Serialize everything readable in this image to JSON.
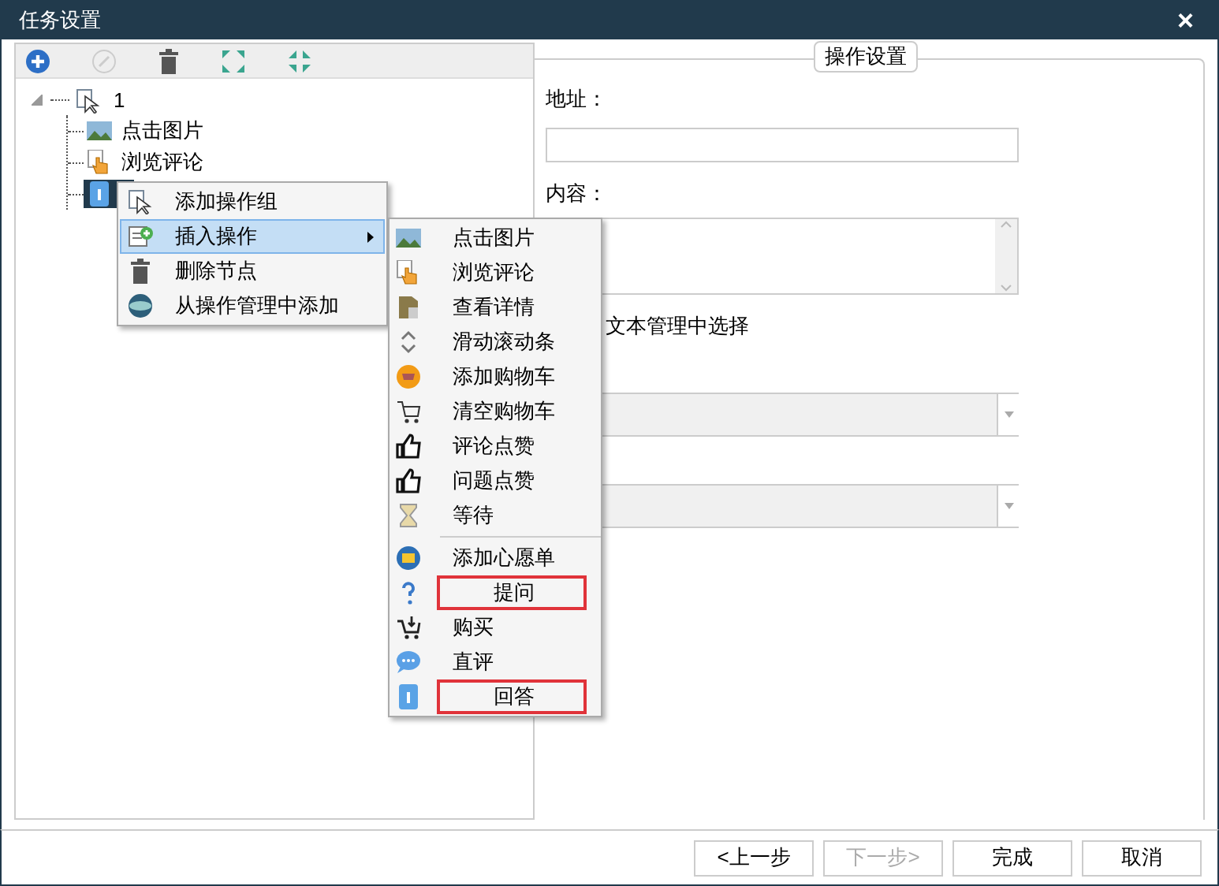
{
  "window": {
    "title": "任务设置",
    "close": "×"
  },
  "tree": {
    "label": "1",
    "expanded": true,
    "children": [
      {
        "label": "点击图片",
        "selected": false
      },
      {
        "label": "浏览评论",
        "selected": false
      },
      {
        "selected": true
      }
    ]
  },
  "settings": {
    "legend": "操作设置",
    "address_label": "地址：",
    "content_label": "内容：",
    "text_source_label": "文本管理中选择"
  },
  "context_menu": [
    {
      "label": "添加操作组",
      "selected": false,
      "submenu": false
    },
    {
      "label": "插入操作",
      "selected": true,
      "submenu": true
    },
    {
      "label": "删除节点",
      "selected": false,
      "submenu": false
    },
    {
      "label": "从操作管理中添加",
      "selected": false,
      "submenu": false
    }
  ],
  "submenu": [
    {
      "label": "点击图片",
      "marked": false
    },
    {
      "label": "浏览评论",
      "marked": false
    },
    {
      "label": "查看详情",
      "marked": false
    },
    {
      "label": "滑动滚动条",
      "marked": false
    },
    {
      "label": "添加购物车",
      "marked": false
    },
    {
      "label": "清空购物车",
      "marked": false
    },
    {
      "label": "评论点赞",
      "marked": false
    },
    {
      "label": "问题点赞",
      "marked": false
    },
    {
      "label": "等待",
      "marked": false,
      "separator_after": true
    },
    {
      "label": "添加心愿单",
      "marked": false
    },
    {
      "label": "提问",
      "marked": true
    },
    {
      "label": "购买",
      "marked": false
    },
    {
      "label": "直评",
      "marked": false
    },
    {
      "label": "回答",
      "marked": true
    }
  ],
  "buttons": [
    {
      "label": "<上一步",
      "disabled": false
    },
    {
      "label": "下一步>",
      "disabled": true
    },
    {
      "label": "完成",
      "disabled": false
    },
    {
      "label": "取消",
      "disabled": false
    }
  ]
}
